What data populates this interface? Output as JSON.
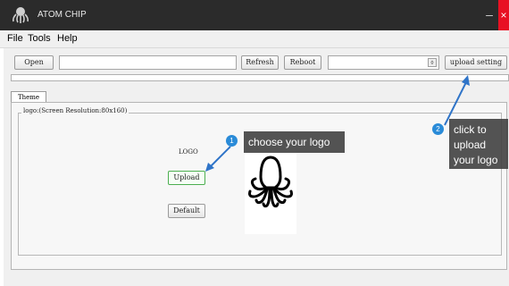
{
  "window": {
    "title": "ATOM CHIP",
    "minimize_glyph": "–",
    "close_glyph": "×"
  },
  "menu": [
    "File",
    "Tools",
    "Help"
  ],
  "toolbar": {
    "open_label": "Open",
    "path_value": "",
    "refresh_label": "Refresh",
    "reboot_label": "Reboot",
    "port_value": "",
    "upload_setting_label": "upload setting"
  },
  "tabs": [
    {
      "label": "Theme",
      "active": true
    }
  ],
  "theme_panel": {
    "group_title": "logo:(Screen Resolution:80x160)",
    "logo_label": "LOGO",
    "upload_label": "Upload",
    "default_label": "Default"
  },
  "annotations": [
    {
      "number": "1",
      "text": "choose your logo"
    },
    {
      "number": "2",
      "text": "click to upload your logo"
    }
  ],
  "colors": {
    "titlebar": "#2b2b2b",
    "close": "#e81123",
    "callout_badge": "#2a8bd8",
    "callout_box": "#3c3c3c",
    "arrow": "#2f74c8",
    "upload_border": "#4caf50"
  },
  "icons": {
    "app": "octopus-icon",
    "logo_preview": "octopus-logo"
  }
}
